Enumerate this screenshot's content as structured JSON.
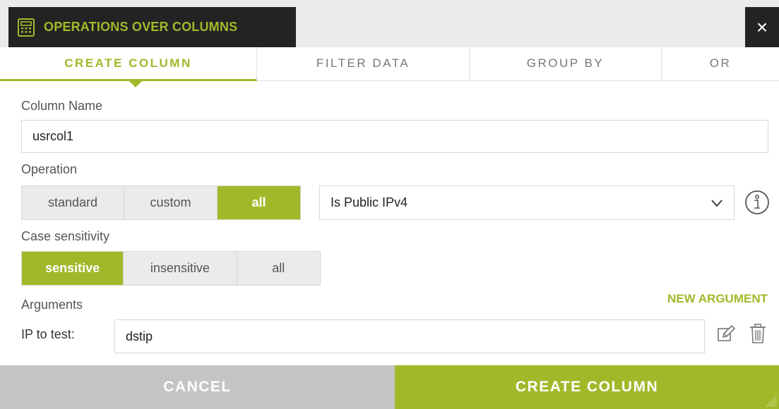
{
  "dialog": {
    "title": "OPERATIONS OVER COLUMNS",
    "title_icon": "calculator-icon",
    "close_label": "×"
  },
  "tabs": [
    {
      "label": "CREATE COLUMN",
      "active": true
    },
    {
      "label": "FILTER DATA",
      "active": false
    },
    {
      "label": "GROUP BY",
      "active": false
    },
    {
      "label": "OR",
      "active": false
    }
  ],
  "form": {
    "column_name_label": "Column Name",
    "column_name_value": "usrcol1",
    "operation_label": "Operation",
    "operation_filters": [
      {
        "label": "standard",
        "active": false
      },
      {
        "label": "custom",
        "active": false
      },
      {
        "label": "all",
        "active": true
      }
    ],
    "operation_selected": "Is Public IPv4",
    "case_label": "Case sensitivity",
    "case_options": [
      {
        "label": "sensitive",
        "active": true
      },
      {
        "label": "insensitive",
        "active": false
      },
      {
        "label": "all",
        "active": false
      }
    ],
    "arguments_label": "Arguments",
    "new_argument_label": "NEW ARGUMENT",
    "arguments": [
      {
        "label": "IP to test:",
        "value": "dstip"
      }
    ]
  },
  "footer": {
    "cancel_label": "CANCEL",
    "create_label": "CREATE COLUMN"
  },
  "colors": {
    "accent": "#a2b82a",
    "dark": "#232323",
    "muted": "#c4c4c4"
  }
}
